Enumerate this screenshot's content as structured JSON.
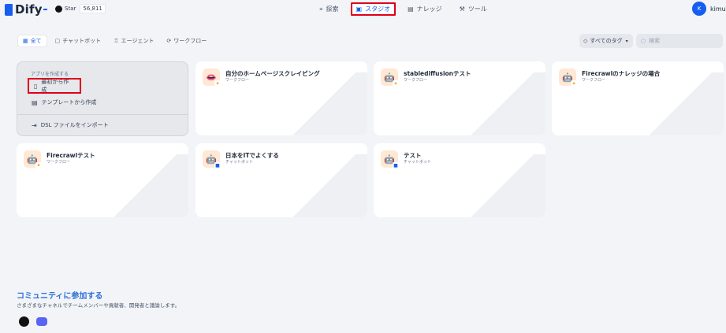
{
  "header": {
    "logo_text": "Dify",
    "github": {
      "star_label": "Star",
      "star_count": "56,811"
    },
    "nav": [
      {
        "label": "探索",
        "icon": "compass-icon"
      },
      {
        "label": "スタジオ",
        "icon": "robot-icon"
      },
      {
        "label": "ナレッジ",
        "icon": "book-icon"
      },
      {
        "label": "ツール",
        "icon": "tool-icon"
      }
    ],
    "user": {
      "initial": "K",
      "name": "kimura"
    }
  },
  "filters": {
    "tabs": [
      {
        "label": "全て",
        "icon": "grid-icon"
      },
      {
        "label": "チャットボット",
        "icon": "chat-icon"
      },
      {
        "label": "エージェント",
        "icon": "agent-icon"
      },
      {
        "label": "ワークフロー",
        "icon": "workflow-icon"
      }
    ],
    "tag_select": "すべてのタグ",
    "search_placeholder": "検索"
  },
  "create": {
    "heading": "アプリを作成する",
    "blank": "最初から作成",
    "template": "テンプレートから作成",
    "dsl": "DSL ファイルをインポート"
  },
  "apps": [
    {
      "title": "自分のホームページスクレイピング",
      "type": "ワークフロー",
      "kind": "workflow"
    },
    {
      "title": "stablediffusionテスト",
      "type": "ワークフロー",
      "kind": "workflow"
    },
    {
      "title": "Firecrawlのナレッジの場合",
      "type": "ワークフロー",
      "kind": "workflow"
    },
    {
      "title": "Firecrawlテスト",
      "type": "ワークフロー",
      "kind": "workflow"
    },
    {
      "title": "日本をITでよくする",
      "type": "チャットボット",
      "kind": "chat"
    },
    {
      "title": "テスト",
      "type": "チャットボット",
      "kind": "chat"
    }
  ],
  "community": {
    "title": "コミュニティに参加する",
    "description": "さまざまなチャネルでチームメンバーや貢献者、開発者と議論します。"
  },
  "colors": {
    "accent": "#155eef",
    "highlight_box": "#e0001b",
    "background": "#f2f4f7"
  }
}
